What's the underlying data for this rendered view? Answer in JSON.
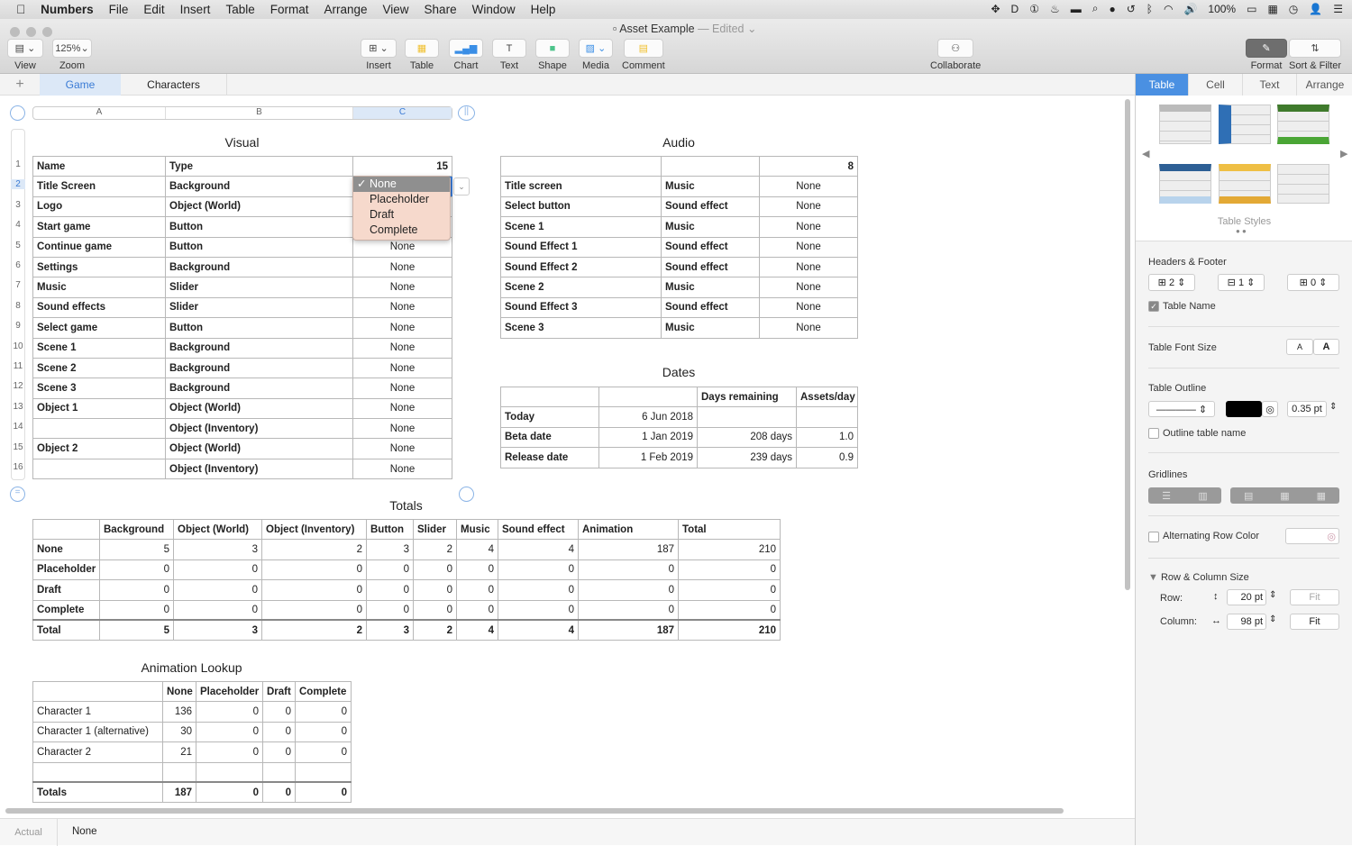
{
  "menubar": {
    "app": "Numbers",
    "items": [
      "File",
      "Edit",
      "Insert",
      "Table",
      "Format",
      "Arrange",
      "View",
      "Share",
      "Window",
      "Help"
    ],
    "battery": "100%"
  },
  "window": {
    "title": "Asset Example",
    "edited": "— Edited"
  },
  "toolbar": {
    "view": "View",
    "zoom_value": "125%",
    "zoom": "Zoom",
    "insert": "Insert",
    "table": "Table",
    "chart": "Chart",
    "text": "Text",
    "shape": "Shape",
    "media": "Media",
    "comment": "Comment",
    "collaborate": "Collaborate",
    "format": "Format",
    "sort_filter": "Sort & Filter"
  },
  "sheets": {
    "add": "+",
    "tabs": [
      "Game",
      "Characters"
    ],
    "active": "Game"
  },
  "column_letters": [
    "A",
    "B",
    "C"
  ],
  "tables": {
    "visual": {
      "title": "Visual",
      "header": [
        "Name",
        "Type",
        "15"
      ],
      "rows": [
        [
          "Title Screen",
          "Background",
          "None"
        ],
        [
          "Logo",
          "Object (World)",
          "None"
        ],
        [
          "Start game",
          "Button",
          "None"
        ],
        [
          "Continue game",
          "Button",
          "None"
        ],
        [
          "Settings",
          "Background",
          "None"
        ],
        [
          "Music",
          "Slider",
          "None"
        ],
        [
          "Sound effects",
          "Slider",
          "None"
        ],
        [
          "Select game",
          "Button",
          "None"
        ],
        [
          "Scene 1",
          "Background",
          "None"
        ],
        [
          "Scene 2",
          "Background",
          "None"
        ],
        [
          "Scene 3",
          "Background",
          "None"
        ],
        [
          "Object 1",
          "Object (World)",
          "None"
        ],
        [
          "",
          "Object (Inventory)",
          "None"
        ],
        [
          "Object 2",
          "Object (World)",
          "None"
        ],
        [
          "",
          "Object (Inventory)",
          "None"
        ]
      ]
    },
    "audio": {
      "title": "Audio",
      "header": [
        "",
        "",
        "8"
      ],
      "rows": [
        [
          "Title screen",
          "Music",
          "None"
        ],
        [
          "Select button",
          "Sound effect",
          "None"
        ],
        [
          "Scene 1",
          "Music",
          "None"
        ],
        [
          "Sound Effect 1",
          "Sound effect",
          "None"
        ],
        [
          "Sound Effect 2",
          "Sound effect",
          "None"
        ],
        [
          "Scene 2",
          "Music",
          "None"
        ],
        [
          "Sound Effect 3",
          "Sound effect",
          "None"
        ],
        [
          "Scene 3",
          "Music",
          "None"
        ]
      ]
    },
    "dates": {
      "title": "Dates",
      "header": [
        "",
        "",
        "Days remaining",
        "Assets/day"
      ],
      "rows": [
        [
          "Today",
          "6 Jun 2018",
          "",
          ""
        ],
        [
          "Beta date",
          "1 Jan 2019",
          "208 days",
          "1.0"
        ],
        [
          "Release date",
          "1 Feb 2019",
          "239 days",
          "0.9"
        ]
      ]
    },
    "totals": {
      "title": "Totals",
      "header": [
        "",
        "Background",
        "Object (World)",
        "Object (Inventory)",
        "Button",
        "Slider",
        "Music",
        "Sound effect",
        "Animation",
        "Total"
      ],
      "rows": [
        [
          "None",
          "5",
          "3",
          "2",
          "3",
          "2",
          "4",
          "4",
          "187",
          "210"
        ],
        [
          "Placeholder",
          "0",
          "0",
          "0",
          "0",
          "0",
          "0",
          "0",
          "0",
          "0"
        ],
        [
          "Draft",
          "0",
          "0",
          "0",
          "0",
          "0",
          "0",
          "0",
          "0",
          "0"
        ],
        [
          "Complete",
          "0",
          "0",
          "0",
          "0",
          "0",
          "0",
          "0",
          "0",
          "0"
        ]
      ],
      "footer": [
        "Total",
        "5",
        "3",
        "2",
        "3",
        "2",
        "4",
        "4",
        "187",
        "210"
      ]
    },
    "animation": {
      "title": "Animation Lookup",
      "header": [
        "",
        "None",
        "Placeholder",
        "Draft",
        "Complete"
      ],
      "rows": [
        [
          "Character 1",
          "136",
          "0",
          "0",
          "0"
        ],
        [
          "Character 1 (alternative)",
          "30",
          "0",
          "0",
          "0"
        ],
        [
          "Character 2",
          "21",
          "0",
          "0",
          "0"
        ],
        [
          "",
          "",
          "",
          "",
          ""
        ]
      ],
      "footer": [
        "Totals",
        "187",
        "0",
        "0",
        "0"
      ]
    }
  },
  "popup": {
    "options": [
      "None",
      "Placeholder",
      "Draft",
      "Complete"
    ],
    "selected": "None",
    "check": "✓"
  },
  "panel": {
    "tabs": [
      "Table",
      "Cell",
      "Text",
      "Arrange"
    ],
    "active": "Table",
    "styles_label": "Table Styles",
    "headers_footer": "Headers & Footer",
    "header_rows": "2",
    "header_cols": "1",
    "footer_rows": "0",
    "table_name": "Table Name",
    "table_name_checked": true,
    "font_size": "Table Font Size",
    "font_small": "A",
    "font_large": "A",
    "outline": "Table Outline",
    "outline_color": "#000000",
    "outline_width": "0.35 pt",
    "outline_name": "Outline table name",
    "gridlines": "Gridlines",
    "alt_row": "Alternating Row Color",
    "row_col_size": "Row & Column Size",
    "row": "Row:",
    "row_value": "20 pt",
    "column": "Column:",
    "column_value": "98 pt",
    "fit": "Fit"
  },
  "bottom": {
    "label": "Actual",
    "value": "None"
  },
  "colors": {
    "accent": "#4a90e2",
    "status_none": "#f2a590",
    "header_gray": "#c4c4c4"
  }
}
